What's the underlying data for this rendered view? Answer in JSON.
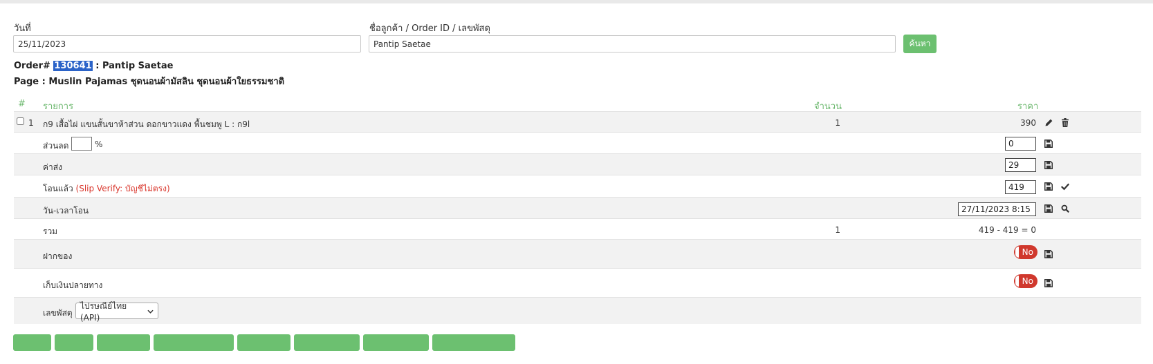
{
  "search": {
    "date_label": "วันที่",
    "date_value": "25/11/2023",
    "customer_label": "ชื่อลูกค้า / Order ID / เลขพัสดุ",
    "customer_value": "Pantip Saetae",
    "search_button": "ค้นหา"
  },
  "order": {
    "prefix": "Order# ",
    "id": "130641",
    "customer_suffix": " : Pantip Saetae",
    "page_line": "Page : Muslin Pajamas ชุดนอนผ้ามัสลิน ชุดนอนผ้าใยธรรมชาติ"
  },
  "table": {
    "headers": {
      "index": "#",
      "item": "รายการ",
      "quantity": "จำนวน",
      "price": "ราคา"
    },
    "items": [
      {
        "index": "1",
        "description": "ก9 เสื้อไผ่ แขนสั้นขาห้าส่วน ดอกขาวแดง พื้นชมพู L : ก9l",
        "quantity": "1",
        "price": "390"
      }
    ]
  },
  "fields": {
    "discount_label": "ส่วนลด",
    "discount_unit": "%",
    "discount_percent_value": "",
    "discount_value": "0",
    "shipping_label": "ค่าส่ง",
    "shipping_value": "29",
    "paid_label": "โอนแล้ว",
    "paid_note": "(Slip Verify: บัญชีไม่ตรง)",
    "paid_value": "419",
    "transfer_datetime_label": "วัน-เวลาโอน",
    "transfer_datetime_value": "27/11/2023 8:15",
    "total_label": "รวม",
    "total_quantity": "1",
    "total_formula": "419 - 419 = 0",
    "deposit_label": "ฝากของ",
    "deposit_toggle": "No",
    "cod_label": "เก็บเงินปลายทาง",
    "cod_toggle": "No",
    "tracking_label": "เลขพัสดุ",
    "tracking_carrier": "ไปรษณีย์ไทย (API)"
  },
  "colors": {
    "accent_green": "#6cc070",
    "header_green": "#6cb86e",
    "toggle_red": "#d0382d",
    "note_red": "#d9352b",
    "highlight_blue": "#2b63c8"
  },
  "icons": [
    "pencil-icon",
    "trash-icon",
    "save-icon",
    "check-icon",
    "search-icon",
    "chevron-down-icon"
  ]
}
